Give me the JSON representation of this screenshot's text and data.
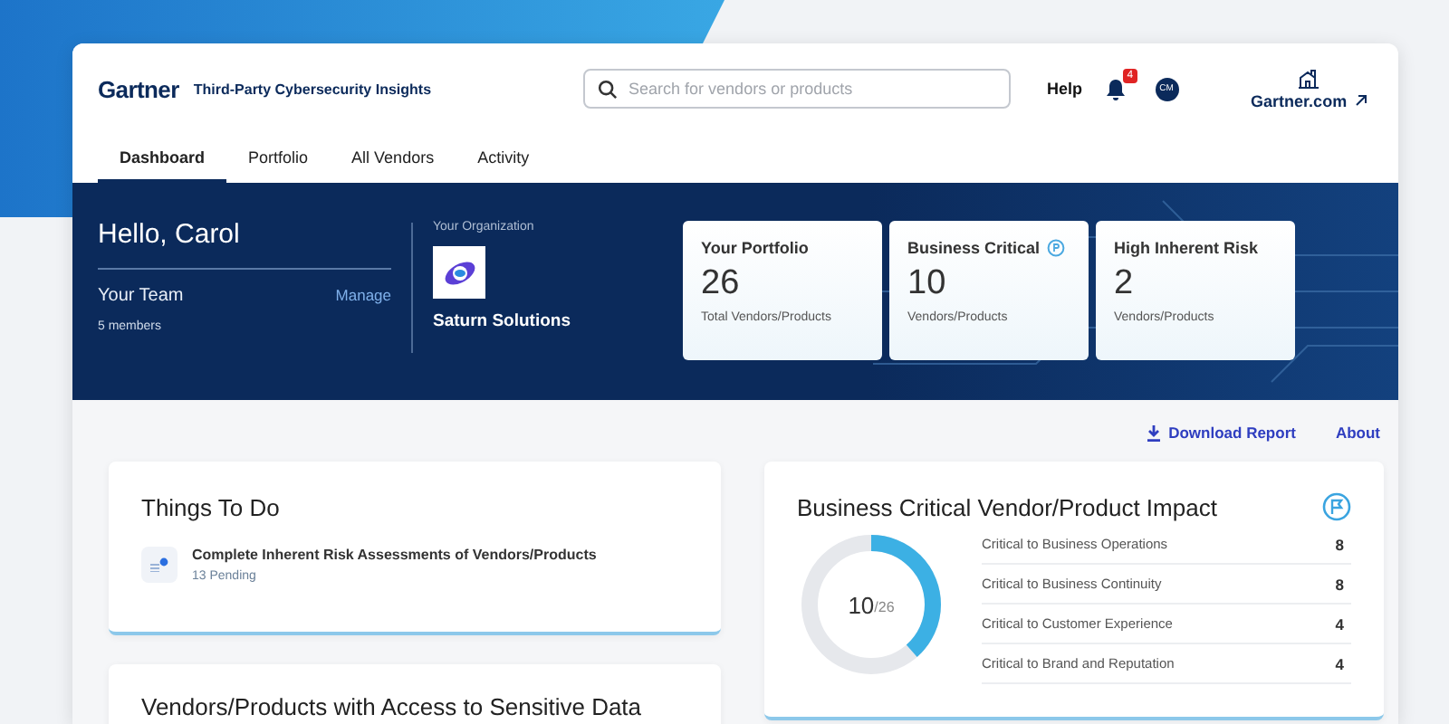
{
  "header": {
    "brand": "Gartner",
    "product": "Third-Party Cybersecurity Insights",
    "search": {
      "placeholder": "Search for vendors or products"
    },
    "help": "Help",
    "notification_count": "4",
    "avatar_initials": "CM",
    "external_link": "Gartner.com"
  },
  "tabs": [
    {
      "label": "Dashboard",
      "selected": true
    },
    {
      "label": "Portfolio",
      "selected": false
    },
    {
      "label": "All Vendors",
      "selected": false
    },
    {
      "label": "Activity",
      "selected": false
    }
  ],
  "hero": {
    "greeting": "Hello, Carol",
    "team_label": "Your Team",
    "manage": "Manage",
    "members": "5 members",
    "org_label": "Your Organization",
    "org_name": "Saturn Solutions",
    "stats": [
      {
        "title": "Your Portfolio",
        "value": "26",
        "caption": "Total Vendors/Products",
        "info": false
      },
      {
        "title": "Business Critical",
        "value": "10",
        "caption": "Vendors/Products",
        "info": true
      },
      {
        "title": "High Inherent Risk",
        "value": "2",
        "caption": "Vendors/Products",
        "info": false
      }
    ]
  },
  "actions": {
    "download": "Download Report",
    "about": "About"
  },
  "todo": {
    "title": "Things To Do",
    "items": [
      {
        "text": "Complete Inherent Risk Assessments of Vendors/Products",
        "status": "13 Pending"
      }
    ]
  },
  "sensitive": {
    "title": "Vendors/Products with Access to Sensitive Data"
  },
  "impact": {
    "title": "Business Critical Vendor/Product Impact",
    "donut": {
      "value": "10",
      "total": "/26",
      "level": 0.385
    },
    "rows": [
      {
        "label": "Critical to Business Operations",
        "count": "8"
      },
      {
        "label": "Critical to Business Continuity",
        "count": "8"
      },
      {
        "label": "Critical to Customer Experience",
        "count": "4"
      },
      {
        "label": "Critical to Brand and Reputation",
        "count": "4"
      }
    ]
  }
}
